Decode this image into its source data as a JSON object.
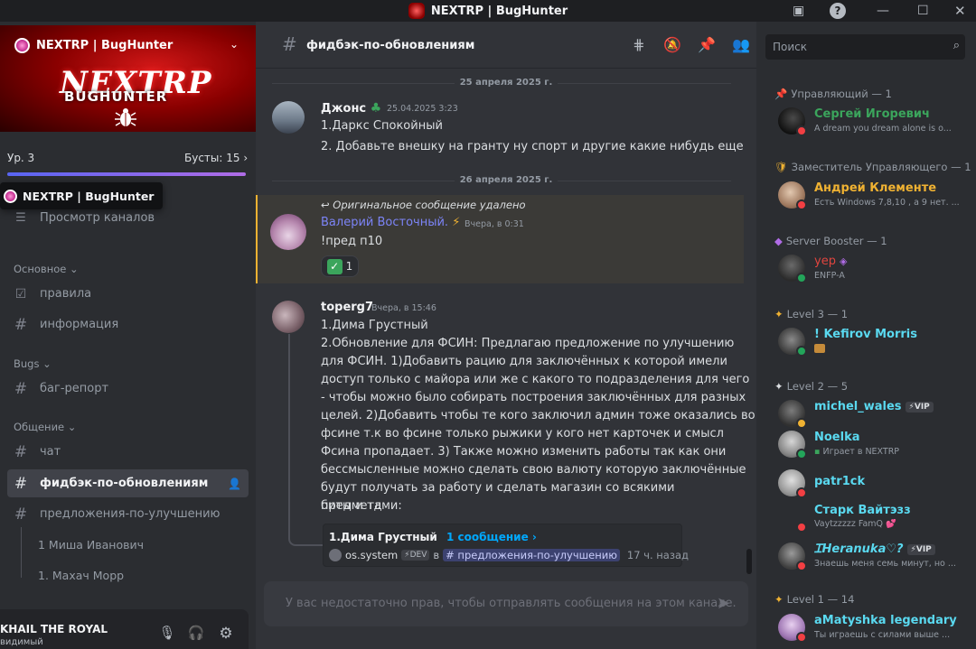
{
  "window": {
    "title": "NEXTRP | BugHunter"
  },
  "server": {
    "name": "NEXTRP | BugHunter",
    "banner_logo_top": "NEXTRP",
    "banner_logo_bottom": "BUGHUNTER",
    "boost_level": "Ур. 3",
    "boost_count": "Бусты: 15",
    "tooltip": "NEXTRP | BugHunter",
    "browse_channels": "Просмотр каналов"
  },
  "categories": {
    "main": "Основное",
    "bugs": "Bugs",
    "chat": "Общение"
  },
  "channels": {
    "rules": "правила",
    "info": "информация",
    "bug_report": "баг-репорт",
    "chat": "чат",
    "feedback": "фидбэк-по-обновлениям",
    "suggestions": "предложения-по-улучшению"
  },
  "threads": [
    "1 Миша Иванович",
    "1. Махач Морр"
  ],
  "user": {
    "name": "KHAIL THE ROYAL",
    "status": "видимый"
  },
  "header": {
    "channel": "фидбэк-по-обновлениям"
  },
  "dividers": [
    "25 апреля 2025 г.",
    "26 апреля 2025 г."
  ],
  "messages": [
    {
      "author": "Джонс",
      "time": "25.04.2025 3:23",
      "lines": [
        "1.Даркс Спокойный",
        "2. Добавьте внешку на гранту ну спорт и другие какие нибудь еще"
      ]
    },
    {
      "reply_ref": "Оригинальное сообщение удалено",
      "author": "Валерий Восточный.",
      "time": "Вчера, в 0:31",
      "lines": [
        "!пред п10"
      ],
      "reaction_count": "1"
    },
    {
      "author": "toperg7",
      "time": "Вчера, в 15:46",
      "lines": [
        "1.Дима Грустный",
        "2.Обновление для ФСИН: Предлагаю предложение по улучшению",
        "для ФСИН. 1)Добавить рацию для заключённых к которой имели",
        "доступ только с майора или же с какого то подразделения для чего",
        "- чтобы можно было собирать построения заключённых для разных",
        "целей. 2)Добавить чтобы те кого заключил админ тоже оказались во",
        "фсине т.к во фсине только рыжики у кого нет карточек и смысл",
        "Фсина пропадает. 3) Также можно изменить работы так как они",
        "бессмысленные можно сделать свою валюту которую заключённые",
        "будут получать за работу и сделать магазин со всякими предметами:",
        "биты и тд"
      ],
      "thread": {
        "title": "1.Дима Грустный",
        "count": "1 сообщение ›",
        "last_author": "os.system",
        "tag": "⚡DEV",
        "in": "в",
        "channel": "# предложения-по-улучшению",
        "ago": "17 ч. назад"
      }
    }
  ],
  "composer": {
    "placeholder": "У вас недостаточно прав, чтобы отправлять сообщения на этом канале."
  },
  "search": {
    "placeholder": "Поиск"
  },
  "member_groups": [
    {
      "role": "Управляющий — 1",
      "color": "#e0453f"
    },
    {
      "role": "Заместитель Управляющего — 1",
      "color": "#f0b232"
    },
    {
      "role": "Server Booster — 1",
      "color": "#b06ce6"
    },
    {
      "role": "Level 3 — 1",
      "color": "#f0b232"
    },
    {
      "role": "Level 2 — 5",
      "color": "#dbdee1"
    },
    {
      "role": "Level 1 — 14",
      "color": "#f0b232"
    }
  ],
  "members": [
    {
      "name": "Сергей Игоревич",
      "sub": "A dream you dream alone is o...",
      "color": "#3ba55c",
      "status": "#f23f43",
      "badge": ""
    },
    {
      "name": "Андрей Клементе",
      "sub": "Есть Windows 7,8,10 , а 9 нет. ...",
      "color": "#f0b232",
      "status": "#f23f43",
      "badge": ""
    },
    {
      "name": "уер",
      "sub": "ENFP-A",
      "color": "#e0453f",
      "status": "#23a55a",
      "badge": ""
    },
    {
      "name": "! Kefirov Morris",
      "sub": "",
      "color": "#5ad9f0",
      "status": "#23a55a",
      "badge": ""
    },
    {
      "name": "michel_wales",
      "sub": "",
      "color": "#5ad9f0",
      "status": "#f0b232",
      "badge": "⚡VIP"
    },
    {
      "name": "Noelka",
      "sub": "Играет в NEXTRP",
      "color": "#5ad9f0",
      "status": "#23a55a",
      "badge": ""
    },
    {
      "name": "patr1ck",
      "sub": "",
      "color": "#5ad9f0",
      "status": "#f23f43",
      "badge": ""
    },
    {
      "name": "Старк Вайтэзз",
      "sub": "Vaytzzzzz FamQ",
      "color": "#5ad9f0",
      "status": "#f23f43",
      "badge": ""
    },
    {
      "name": "ᏆHeranuka♡?",
      "sub": "Знаешь меня семь минут, но ...",
      "color": "#5ad9f0",
      "status": "#f23f43",
      "badge": "⚡VIP"
    },
    {
      "name": "aMatyshka legendary",
      "sub": "Ты играешь с силами выше ...",
      "color": "#5ad9f0",
      "status": "#f23f43",
      "badge": ""
    }
  ],
  "colors": {
    "accent": "#5865f2",
    "mention": "#00a8fc",
    "highlight_border": "#f0b232",
    "author_valeriy": "#7c84f7"
  }
}
